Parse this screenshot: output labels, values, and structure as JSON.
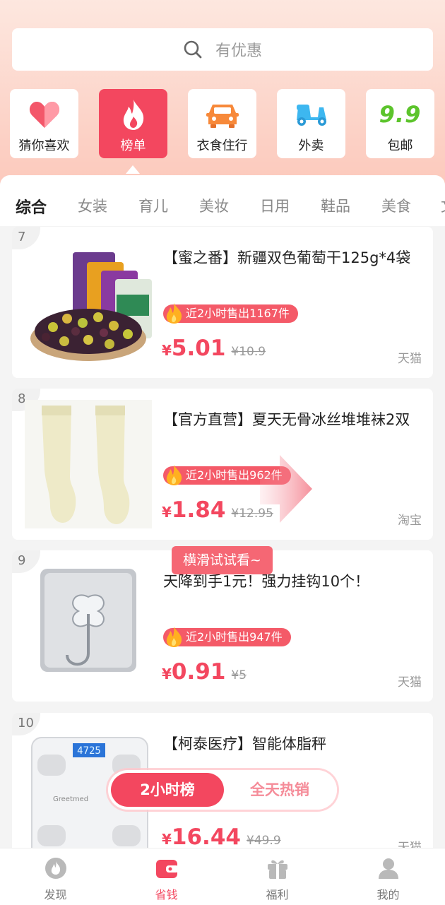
{
  "search": {
    "placeholder": "有优惠"
  },
  "categories": [
    {
      "label": "猜你喜欢",
      "icon": "heart-icon"
    },
    {
      "label": "榜单",
      "icon": "flame-icon",
      "active": true
    },
    {
      "label": "衣食住行",
      "icon": "car-icon"
    },
    {
      "label": "外卖",
      "icon": "scooter-icon"
    },
    {
      "label": "包邮",
      "icon": "nine-nine-icon",
      "badge": "9.9"
    }
  ],
  "tabs": [
    "综合",
    "女装",
    "育儿",
    "美妆",
    "日用",
    "鞋品",
    "美食",
    "文"
  ],
  "products": [
    {
      "rank": "7",
      "title": "【蜜之番】新疆双色葡萄干125g*4袋",
      "sold": "近2小时售出1167件",
      "currency": "¥",
      "price": "5.01",
      "original": "¥10.9",
      "shop": "天猫"
    },
    {
      "rank": "8",
      "title": "【官方直营】夏天无骨冰丝堆堆袜2双",
      "sold": "近2小时售出962件",
      "currency": "¥",
      "price": "1.84",
      "original": "¥12.95",
      "shop": "淘宝"
    },
    {
      "rank": "9",
      "title": "天降到手1元！强力挂钩10个！",
      "sold": "近2小时售出947件",
      "currency": "¥",
      "price": "0.91",
      "original": "¥5",
      "shop": "天猫"
    },
    {
      "rank": "10",
      "title": "【柯泰医疗】智能体脂秤",
      "currency": "¥",
      "price": "16.44",
      "original": "¥49.9",
      "shop": "天猫",
      "scale_brand": "Greetmed",
      "scale_reading": "4725"
    }
  ],
  "swipe_hint": "横滑试试看~",
  "toggle": {
    "option_on": "2小时榜",
    "option_off": "全天热销"
  },
  "bottom_nav": [
    {
      "label": "发现",
      "icon": "flame-icon"
    },
    {
      "label": "省钱",
      "icon": "wallet-icon",
      "active": true
    },
    {
      "label": "福利",
      "icon": "gift-icon"
    },
    {
      "label": "我的",
      "icon": "user-icon"
    }
  ],
  "colors": {
    "accent": "#f3475f",
    "sold_badge": "#f45a68",
    "header_gradient_start": "#fde7df",
    "header_gradient_end": "#fcc9bc"
  }
}
